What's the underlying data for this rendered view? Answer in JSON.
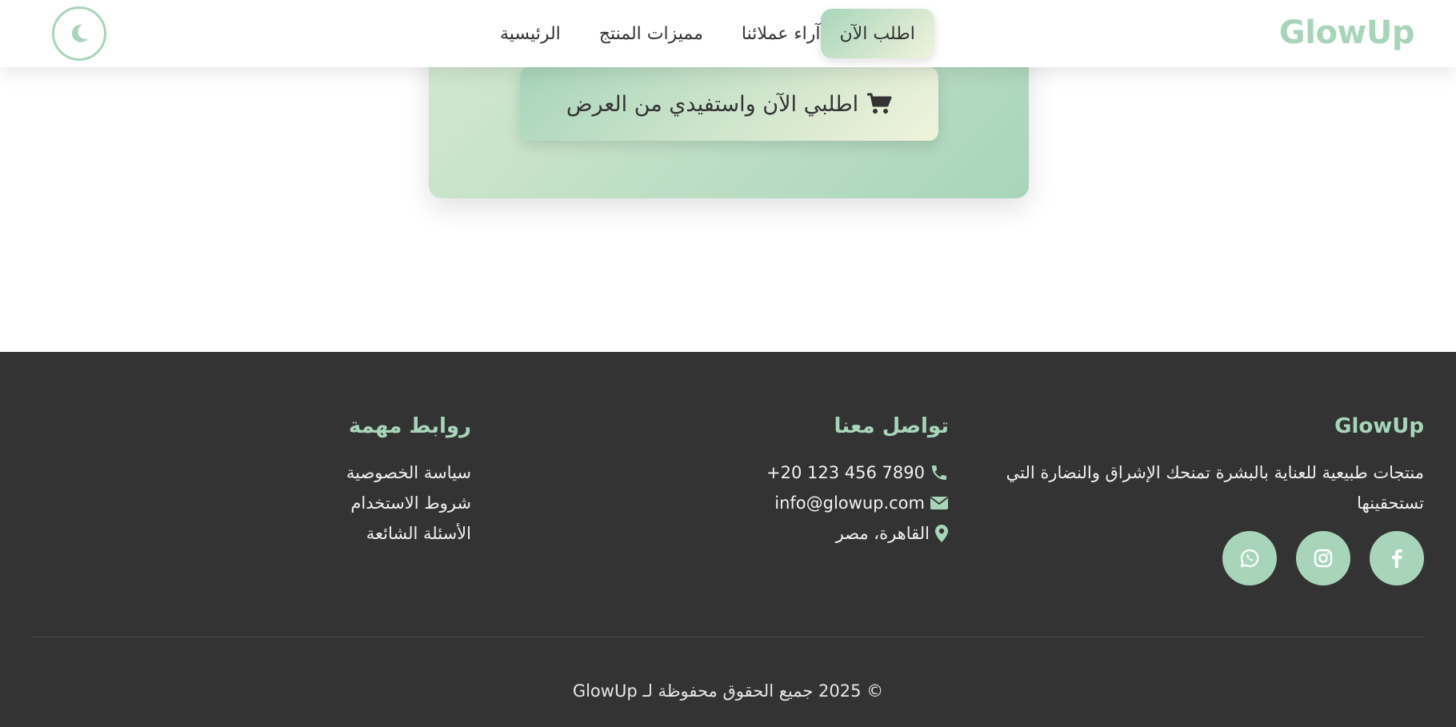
{
  "header": {
    "brand": "GlowUp",
    "nav": {
      "home": "الرئيسية",
      "features": "مميزات المنتج",
      "reviews": "آراء عملائنا",
      "order": "اطلب الآن"
    },
    "theme_toggle_icon": "moon-icon"
  },
  "offer": {
    "button_label": "اطلبي الآن واستفيدي من العرض",
    "button_icon": "cart-icon"
  },
  "footer": {
    "about": {
      "title": "GlowUp",
      "text": "منتجات طبيعية للعناية بالبشرة تمنحك الإشراق والنضارة التي تستحقينها",
      "social": [
        "facebook-icon",
        "instagram-icon",
        "whatsapp-icon"
      ]
    },
    "contact": {
      "title": "تواصل معنا",
      "phone": "+20 123 456 7890",
      "email": "info@glowup.com",
      "address": "القاهرة، مصر"
    },
    "links": {
      "title": "روابط مهمة",
      "items": [
        "سياسة الخصوصية",
        "شروط الاستخدام",
        "الأسئلة الشائعة"
      ]
    },
    "copyright": "© 2025 جميع الحقوق محفوظة لـ GlowUp"
  },
  "colors": {
    "accent": "#a8d5ba",
    "accent_light": "#f0f3dc",
    "footer_bg": "#333333",
    "text": "#333333"
  }
}
